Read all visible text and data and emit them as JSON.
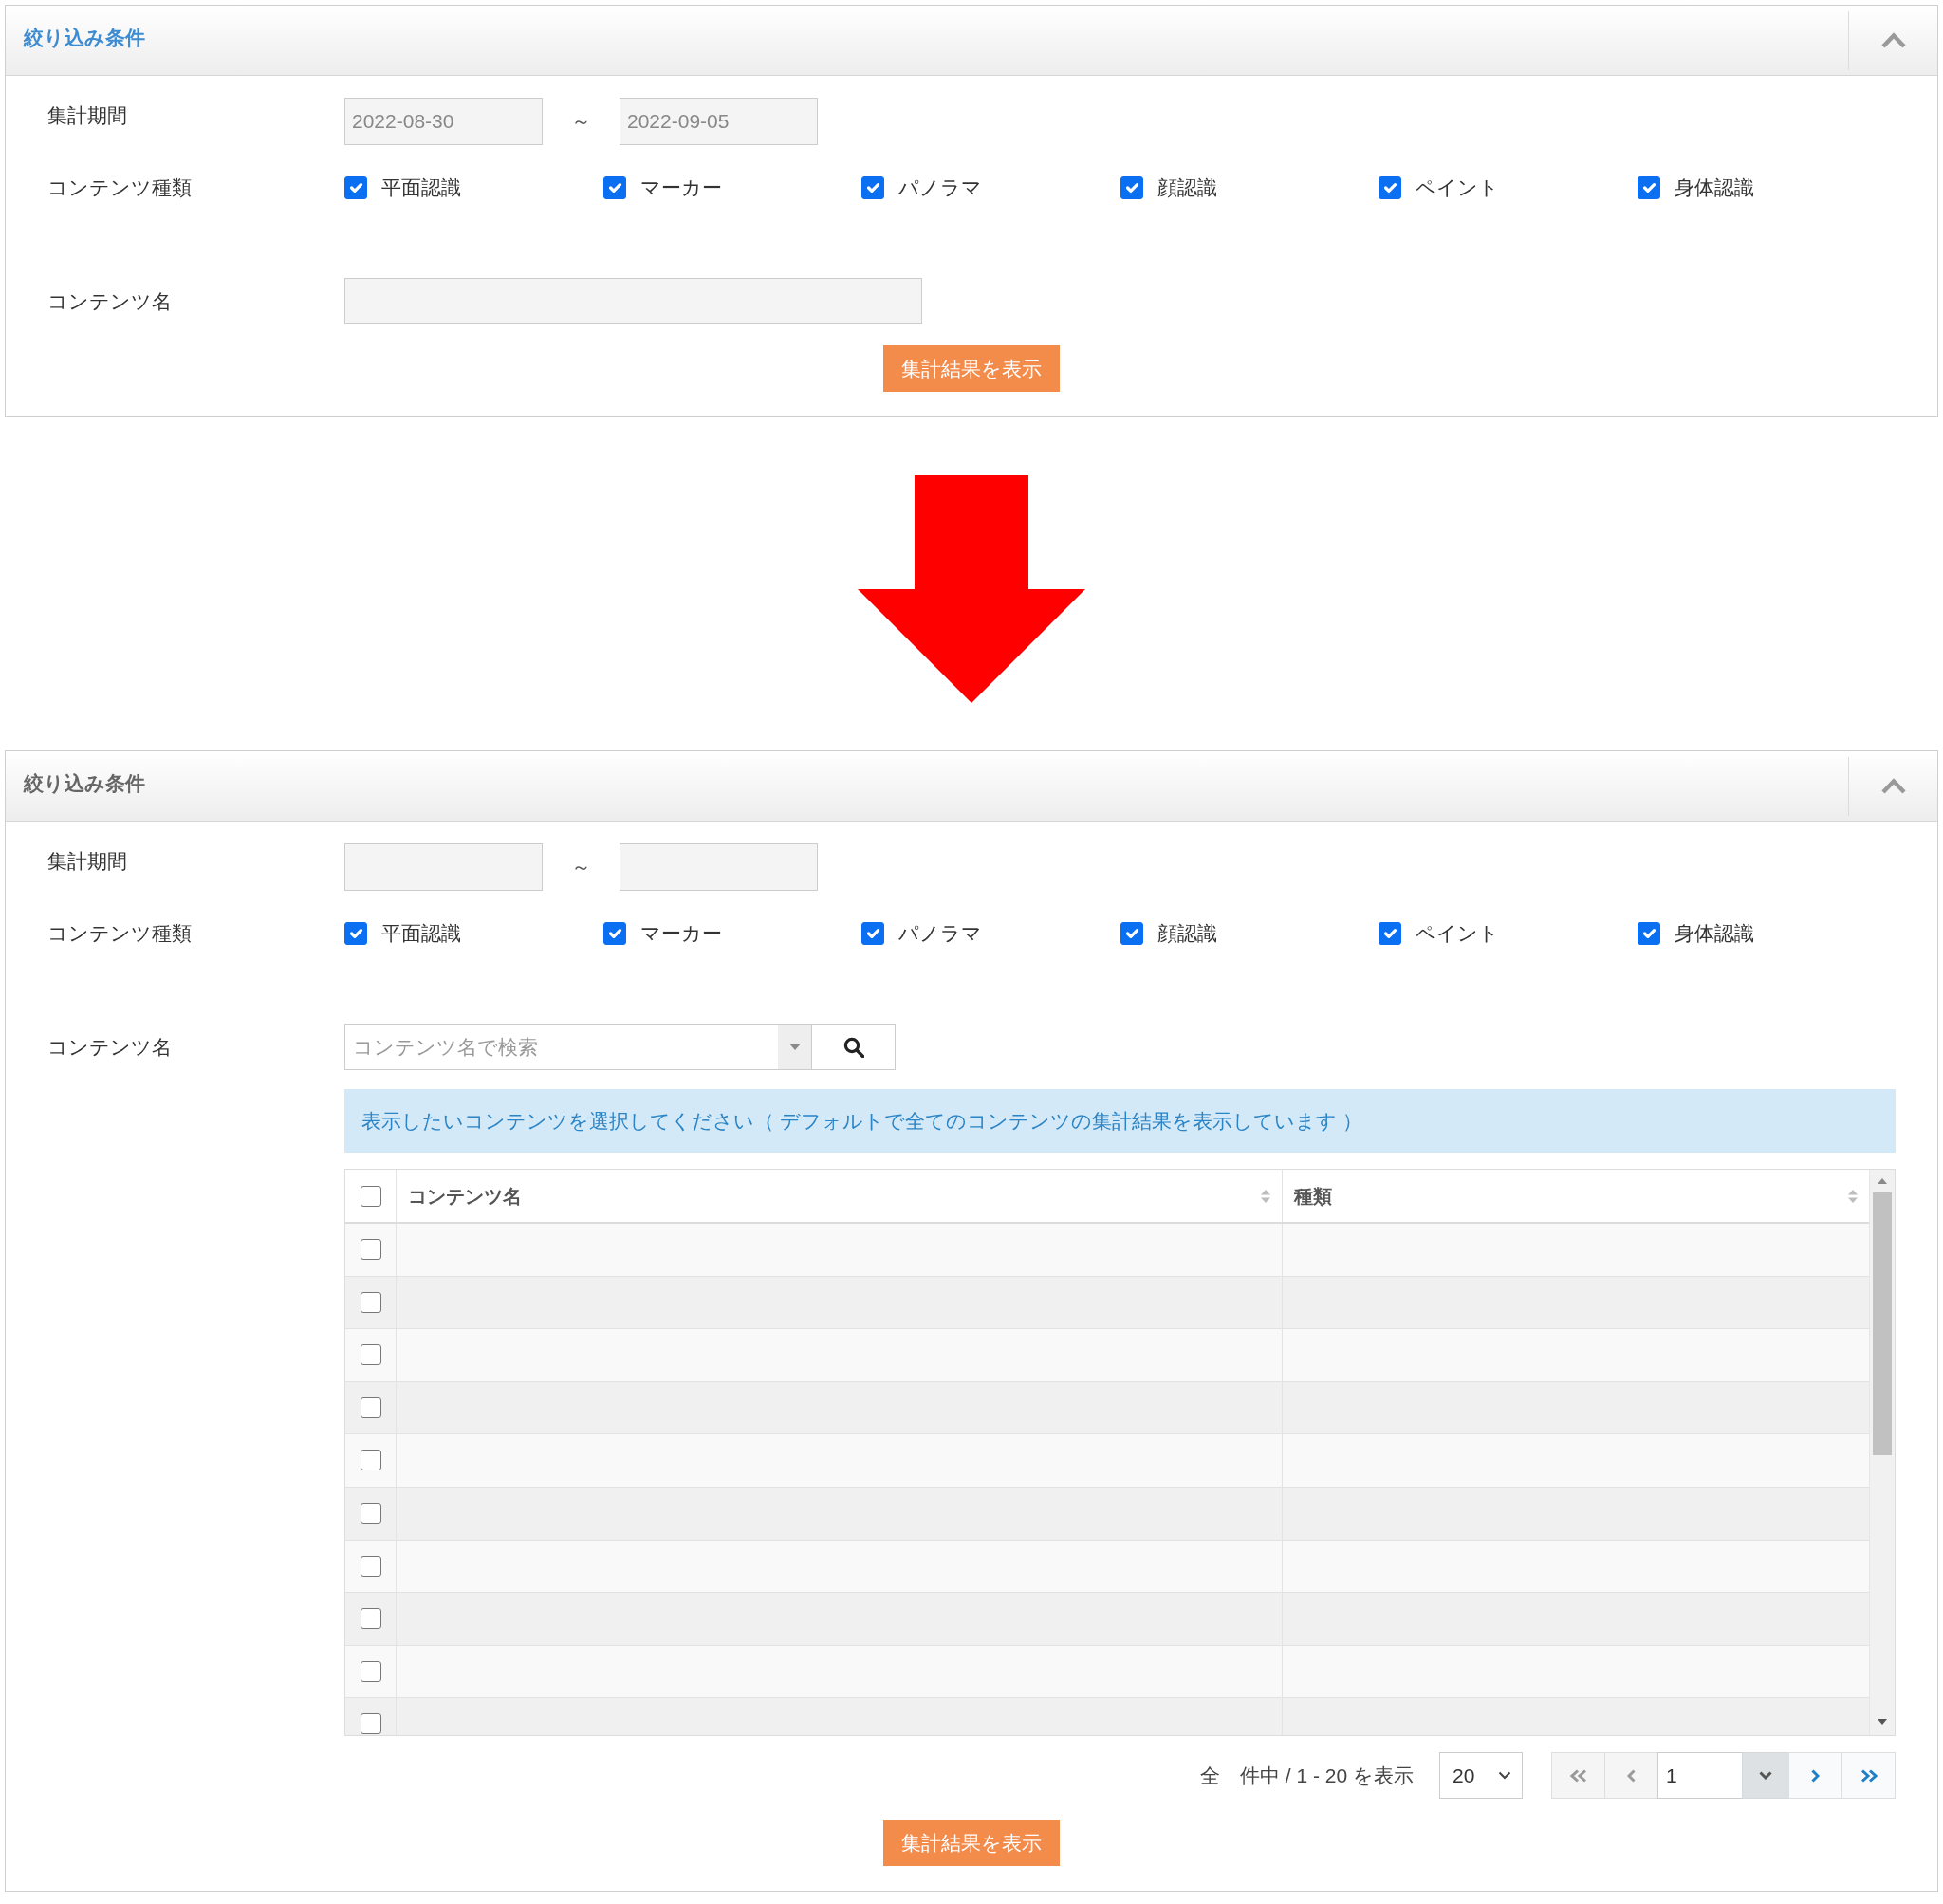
{
  "panels": [
    {
      "title": "絞り込み条件",
      "title_active": true,
      "expanded": true,
      "period": {
        "label": "集計期間",
        "from": "2022-08-30",
        "separator": "～",
        "to": "2022-09-05"
      },
      "content_types": {
        "label": "コンテンツ種類",
        "options": [
          {
            "label": "平面認識",
            "checked": true
          },
          {
            "label": "マーカー",
            "checked": true
          },
          {
            "label": "パノラマ",
            "checked": true
          },
          {
            "label": "顔認識",
            "checked": true
          },
          {
            "label": "ペイント",
            "checked": true
          },
          {
            "label": "身体認識",
            "checked": true
          }
        ]
      },
      "content_name": {
        "label": "コンテンツ名",
        "kind": "text"
      },
      "submit": "集計結果を表示"
    },
    {
      "title": "絞り込み条件",
      "title_active": false,
      "expanded": true,
      "period": {
        "label": "集計期間",
        "separator": "～"
      },
      "content_types": {
        "label": "コンテンツ種類",
        "options": [
          {
            "label": "平面認識",
            "checked": true
          },
          {
            "label": "マーカー",
            "checked": true
          },
          {
            "label": "パノラマ",
            "checked": true
          },
          {
            "label": "顔認識",
            "checked": true
          },
          {
            "label": "ペイント",
            "checked": true
          },
          {
            "label": "身体認識",
            "checked": true
          }
        ]
      },
      "content_name": {
        "label": "コンテンツ名",
        "kind": "search",
        "placeholder": "コンテンツ名で検索"
      },
      "notice": "表示したいコンテンツを選択してください（ デフォルトで全てのコンテンツの集計結果を表示しています ）",
      "table": {
        "all_checked": false,
        "columns": [
          {
            "label": "コンテンツ名"
          },
          {
            "label": "種類"
          }
        ],
        "rows": [
          {
            "checked": false
          },
          {
            "checked": false
          },
          {
            "checked": false
          },
          {
            "checked": false
          },
          {
            "checked": false
          },
          {
            "checked": false
          },
          {
            "checked": false
          },
          {
            "checked": false
          },
          {
            "checked": false
          },
          {
            "checked": false
          }
        ]
      },
      "pagination": {
        "summary": "全　件中 / 1 - 20 を表示",
        "page_size": "20",
        "page": "1",
        "first": {
          "disabled": true
        },
        "prev": {
          "disabled": true
        },
        "next": {
          "disabled": false
        },
        "last": {
          "disabled": false
        }
      },
      "submit": "集計結果を表示"
    }
  ]
}
